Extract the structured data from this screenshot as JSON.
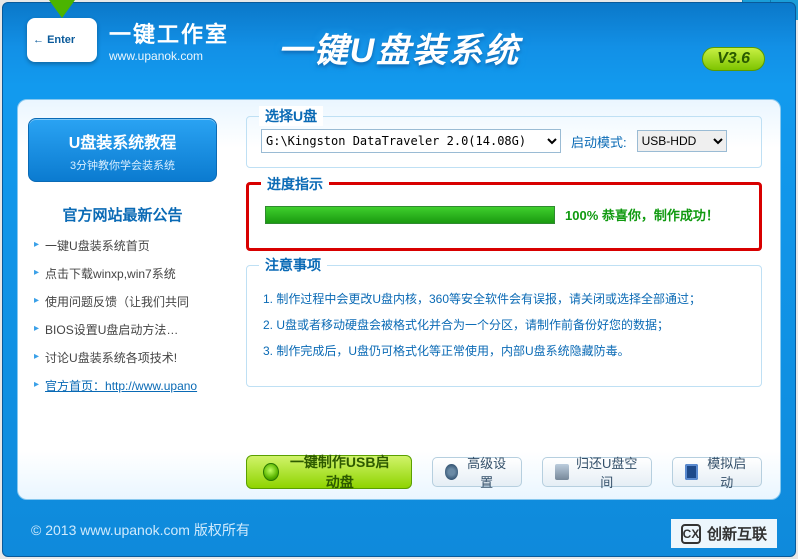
{
  "header": {
    "brand_main": "一键工作室",
    "brand_sub": "www.upanok.com",
    "app_title": "一键U盘装系统",
    "version": "V3.6",
    "logo_enter": "Enter"
  },
  "titlebar": {
    "min": "—",
    "close": "x"
  },
  "left": {
    "tutorial_title": "U盘装系统教程",
    "tutorial_sub": "3分钟教你学会装系统",
    "announce_heading": "官方网站最新公告",
    "links": [
      "一键U盘装系统首页",
      "点击下载winxp,win7系统",
      "使用问题反馈（让我们共同",
      "BIOS设置U盘启动方法…",
      "讨论U盘装系统各项技术!",
      "官方首页：http://www.upano"
    ]
  },
  "select_drive": {
    "legend": "选择U盘",
    "drive_value": "G:\\Kingston DataTraveler 2.0(14.08G)",
    "boot_mode_label": "启动模式:",
    "boot_mode_value": "USB-HDD"
  },
  "progress": {
    "legend": "进度指示",
    "percent": 100,
    "status": "100%  恭喜你，制作成功！"
  },
  "notes": {
    "legend": "注意事项",
    "items": [
      "1. 制作过程中会更改U盘内核，360等安全软件会有误报，请关闭或选择全部通过；",
      "2. U盘或者移动硬盘会被格式化并合为一个分区，请制作前备份好您的数据；",
      "3. 制作完成后，U盘仍可格式化等正常使用，内部U盘系统隐藏防毒。"
    ]
  },
  "buttons": {
    "make": "一键制作USB启动盘",
    "advanced": "高级设置",
    "restore": "归还U盘空间",
    "simulate": "模拟启动"
  },
  "footer": "© 2013 www.upanok.com   版权所有",
  "watermark": "创新互联"
}
